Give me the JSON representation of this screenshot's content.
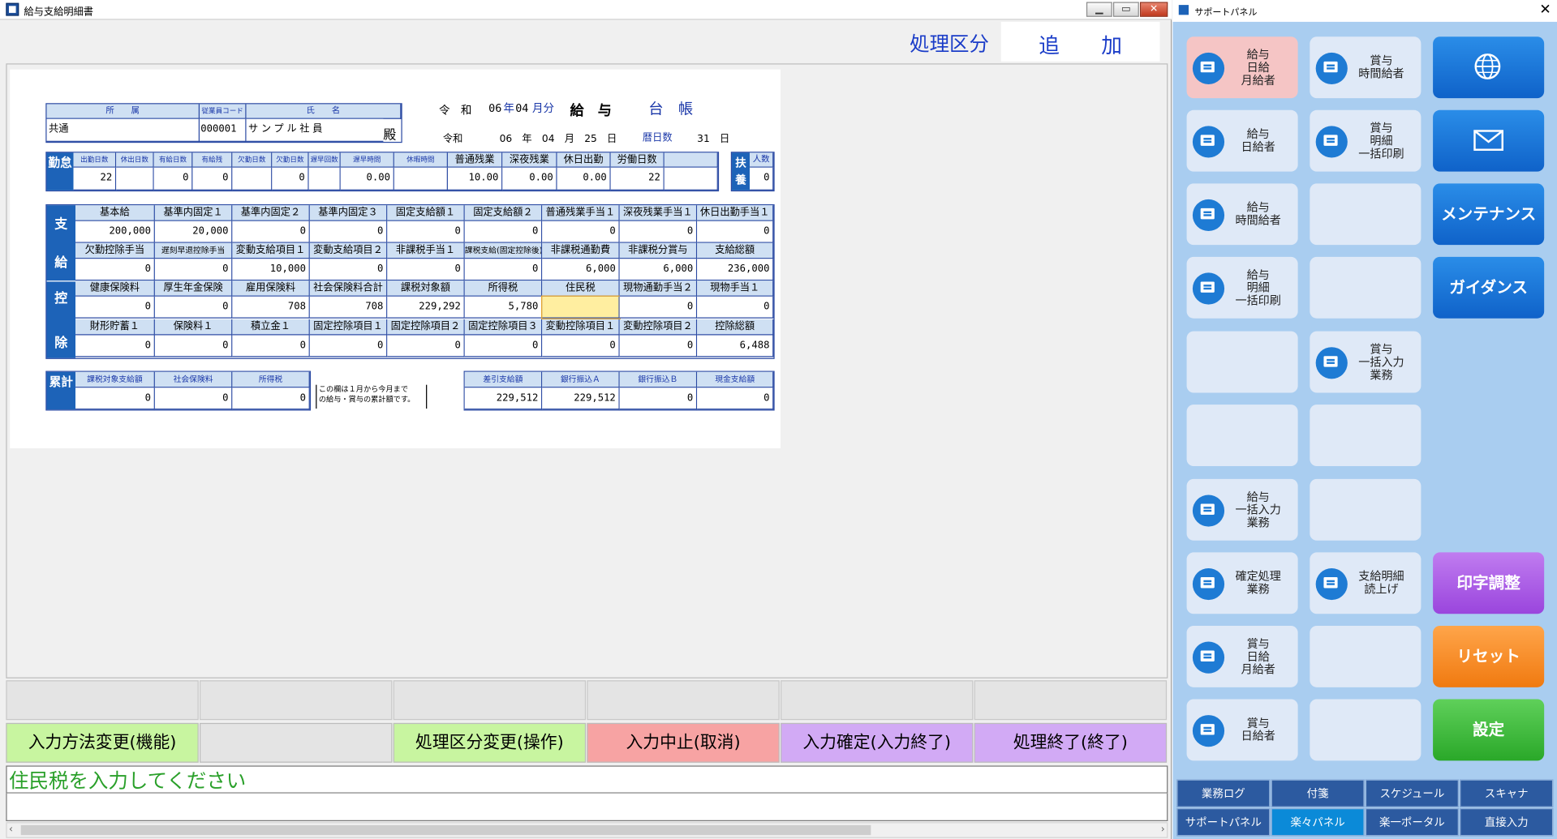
{
  "window": {
    "title": "給与支給明細書",
    "controls": {
      "minimize": "▁",
      "maximize": "▭",
      "close": "✕"
    }
  },
  "shori": {
    "label": "処理区分",
    "value": "追加"
  },
  "slip": {
    "header": {
      "dept_header": "所　　属",
      "code_header": "従業員コード",
      "name_header": "氏　　名",
      "dept": "共通",
      "code": "000001",
      "name": "サンプル社員",
      "dono": "殿",
      "era1": "令　和",
      "year1": "06",
      "nen": "年",
      "month1": "04",
      "gatsu_bun": "月分",
      "kyuyo": "給　与",
      "daicho": "台　帳",
      "era2": "令和",
      "date2": "06　年　04　月　25　日",
      "reki_label": "暦日数",
      "reki_value": "31　日"
    },
    "kintai": {
      "side": "勤怠",
      "headers": [
        "出勤日数",
        "休出日数",
        "有給日数",
        "有給残",
        "欠勤日数",
        "欠勤日数",
        "遅早回数",
        "遅早時間",
        "休暇時間",
        "普通残業",
        "深夜残業",
        "休日出勤",
        "労働日数",
        ""
      ],
      "values": [
        "22",
        "",
        "0",
        "0",
        "",
        "0",
        "",
        "0.00",
        "",
        "10.00",
        "0.00",
        "0.00",
        "22",
        ""
      ],
      "fuyou_side": "扶養",
      "fuyou_header": "人数",
      "fuyou_value": "0"
    },
    "shikyu": {
      "side1": "支",
      "side2": "給",
      "row1_headers": [
        "基本給",
        "基準内固定１",
        "基準内固定２",
        "基準内固定３",
        "固定支給額１",
        "固定支給額２",
        "普通残業手当１",
        "深夜残業手当１",
        "休日出勤手当１"
      ],
      "row1_values": [
        "200,000",
        "20,000",
        "0",
        "0",
        "0",
        "0",
        "0",
        "0",
        "0"
      ],
      "row2_headers": [
        "欠勤控除手当",
        "遅刻早退控除手当",
        "変動支給項目１",
        "変動支給項目２",
        "非課税手当１",
        "課税支給(固定控除後)",
        "非課税通勤費",
        "非課税分賞与",
        "支給総額"
      ],
      "row2_values": [
        "0",
        "0",
        "10,000",
        "0",
        "0",
        "0",
        "6,000",
        "6,000",
        "236,000"
      ]
    },
    "kojo": {
      "side1": "控",
      "side2": "除",
      "row1_headers": [
        "健康保険料",
        "厚生年金保険",
        "雇用保険料",
        "社会保険料合計",
        "課税対象額",
        "所得税",
        "住民税",
        "現物通勤手当２",
        "現物手当１"
      ],
      "row1_values": [
        "0",
        "0",
        "708",
        "708",
        "229,292",
        "5,780",
        "",
        "0",
        "0"
      ],
      "row2_headers": [
        "財形貯蓄１",
        "保険料１",
        "積立金１",
        "固定控除項目１",
        "固定控除項目２",
        "固定控除項目３",
        "変動控除項目１",
        "変動控除項目２",
        "控除総額"
      ],
      "row2_values": [
        "0",
        "0",
        "0",
        "0",
        "0",
        "0",
        "0",
        "0",
        "6,488"
      ]
    },
    "ruikei": {
      "side": "累計",
      "headers": [
        "課税対象支給額",
        "社会保険料",
        "所得税"
      ],
      "values": [
        "0",
        "0",
        "0"
      ],
      "note": "この欄は１月から今月まで\nの給与・賞与の累計額です。"
    },
    "totals": {
      "headers": [
        "差引支給額",
        "銀行振込Ａ",
        "銀行振込Ｂ",
        "現金支給額"
      ],
      "values": [
        "229,512",
        "229,512",
        "0",
        "0"
      ]
    }
  },
  "fkeys": {
    "f1": "入力方法変更(機能)",
    "f3": "処理区分変更(操作)",
    "f4": "入力中止(取消)",
    "f5": "入力確定(入力終了)",
    "f6": "処理終了(終了)"
  },
  "message": "住民税を入力してください",
  "panel": {
    "title": "サポートパネル",
    "close": "✕",
    "col1": [
      "給与\n日給\n月給者",
      "給与\n日給者",
      "給与\n時間給者",
      "給与\n明細\n一括印刷",
      "",
      "",
      "給与\n一括入力\n業務",
      "確定処理\n業務",
      "賞与\n日給\n月給者",
      "賞与\n日給者"
    ],
    "col2": [
      "賞与\n時間給者",
      "賞与\n明細\n一括印刷",
      "",
      "",
      "賞与\n一括入力\n業務",
      "",
      "",
      "支給明細\n読上げ",
      "",
      ""
    ],
    "col3": {
      "web_icon": "globe-icon",
      "mail_icon": "mail-icon",
      "maintenance": "メンテナンス",
      "guidance": "ガイダンス",
      "print_adjust": "印字調整",
      "reset": "リセット",
      "settings": "設定"
    },
    "tabs_row1": [
      "業務ログ",
      "付箋",
      "スケジュール",
      "スキャナ"
    ],
    "tabs_row2": [
      "サポートパネル",
      "楽々パネル",
      "楽一ポータル",
      "直接入力"
    ],
    "selected_tab": "楽々パネル"
  },
  "colors": {
    "accent": "#1a3cc8",
    "slip_header": "#cfe0f3",
    "side_blue": "#1d63b8",
    "fkey_green": "#c8f5a0",
    "fkey_pink": "#f7a3a3",
    "fkey_purple": "#d2aaf5",
    "message_green": "#2aa02a"
  }
}
